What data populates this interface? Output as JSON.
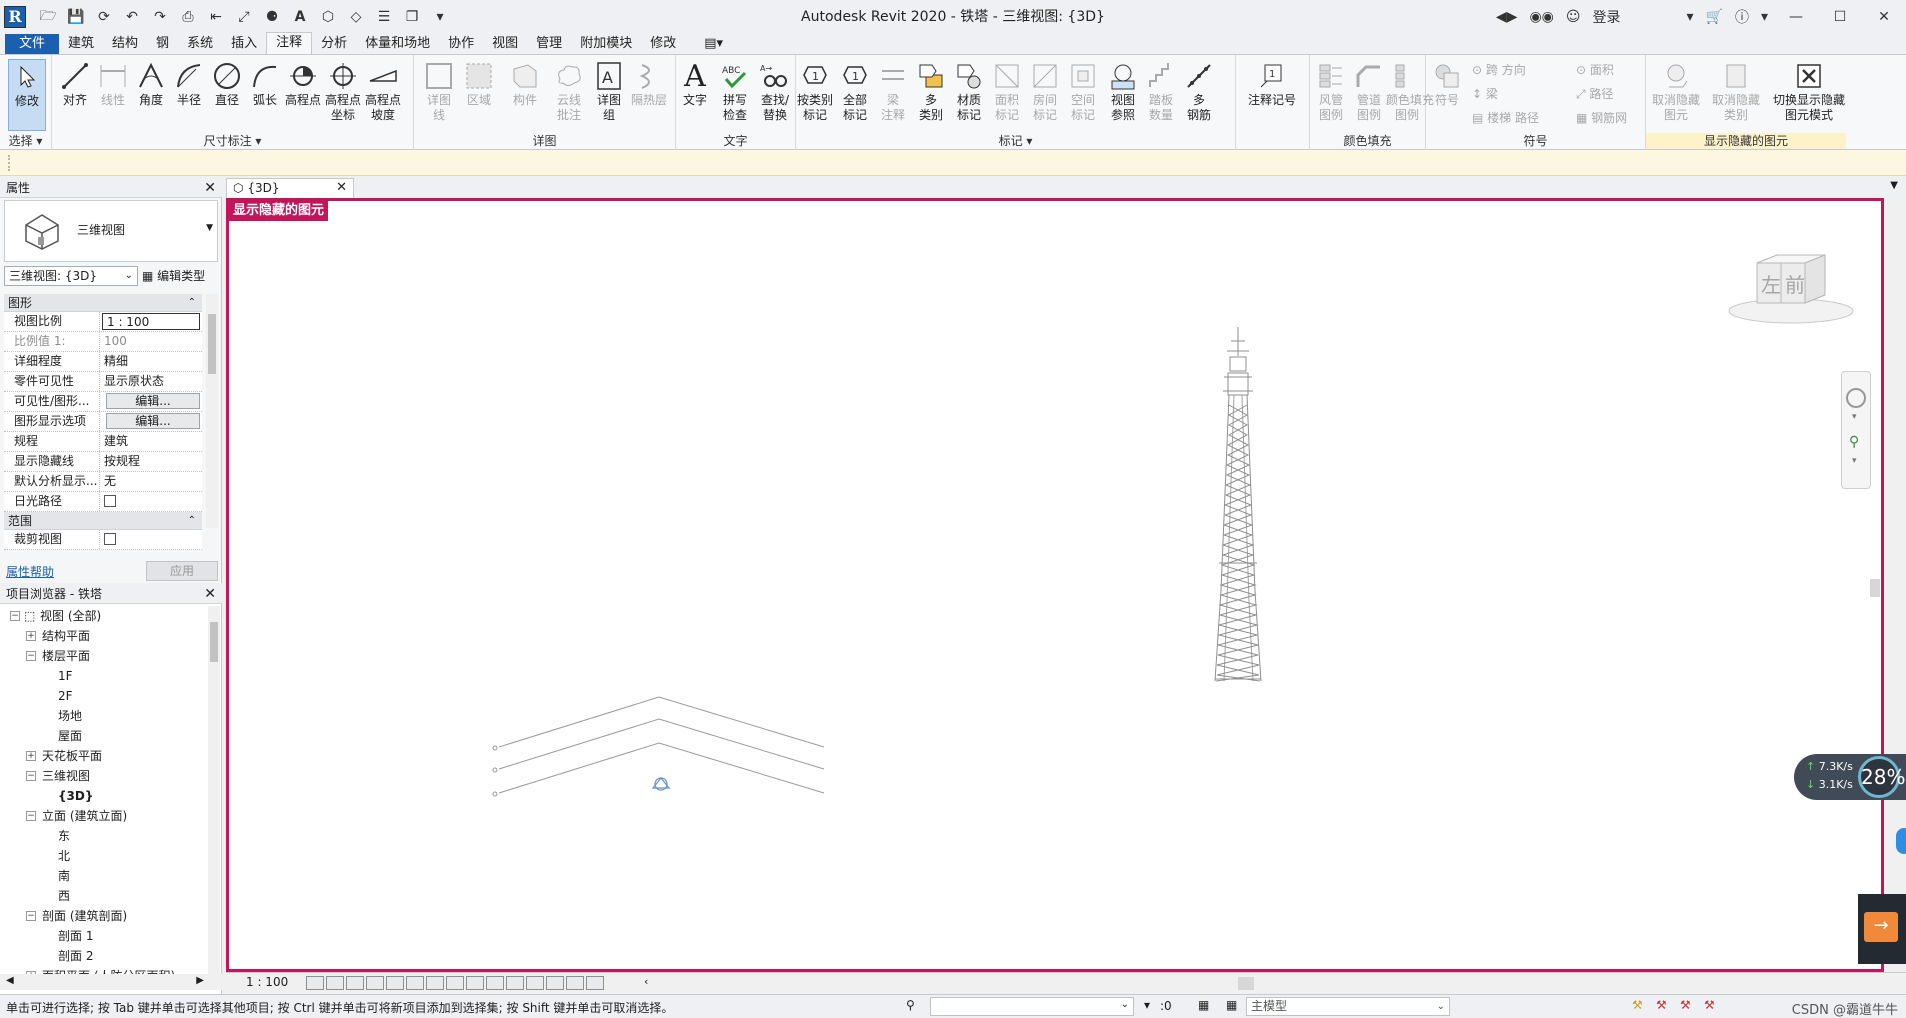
{
  "titlebar": {
    "title": "Autodesk Revit 2020 - 铁塔 - 三维视图: {3D}",
    "login_label": "登录"
  },
  "menu_tabs": [
    "文件",
    "建筑",
    "结构",
    "钢",
    "系统",
    "插入",
    "注释",
    "分析",
    "体量和场地",
    "协作",
    "视图",
    "管理",
    "附加模块",
    "修改"
  ],
  "active_tab": "注释",
  "ribbon": {
    "select_panel": {
      "modify": "修改",
      "title": "选择"
    },
    "dimension_panel": {
      "tools": [
        "对齐",
        "线性",
        "角度",
        "半径",
        "直径",
        "弧长",
        "高程点",
        "高程点\n坐标",
        "高程点\n坡度"
      ],
      "title": "尺寸标注"
    },
    "detail_panel": {
      "tools": [
        "详图\n线",
        "区域",
        "构件",
        "云线\n批注",
        "详图\n组",
        "隔热层"
      ],
      "title": "详图"
    },
    "text_panel": {
      "tools": [
        "文字",
        "拼写\n检查",
        "查找/\n替换"
      ],
      "title": "文字"
    },
    "tag_panel": {
      "tools": [
        "按类别\n标记",
        "全部\n标记",
        "梁\n注释",
        "多\n类别",
        "材质\n标记",
        "面积\n标记",
        "房间\n标记",
        "空间\n标记",
        "视图\n参照",
        "踏板\n数量",
        "多\n钢筋"
      ],
      "title": "标记"
    },
    "keynote_panel": {
      "tools": [
        "注释记号"
      ]
    },
    "color_fill_panel": {
      "tools": [
        "风管\n图例",
        "管道\n图例",
        "颜色填充\n图例"
      ],
      "title": "颜色填充"
    },
    "symbol_panel": {
      "tools": [
        "符号"
      ],
      "small_tools": [
        "跨 方向",
        "梁",
        "楼梯",
        "路径",
        "面积",
        "路径",
        "钢筋网"
      ],
      "title": "符号"
    },
    "reveal_panel": {
      "tools": [
        "取消隐藏\n图元",
        "取消隐藏\n类别",
        "切换显示隐藏\n图元模式"
      ],
      "title": "显示隐藏的图元"
    }
  },
  "properties": {
    "title": "属性",
    "type_name": "三维视图",
    "view_selector": "三维视图: {3D}",
    "edit_type": "编辑类型",
    "groups": [
      {
        "name": "图形",
        "rows": [
          {
            "k": "视图比例",
            "v": "1 : 100"
          },
          {
            "k": "比例值 1:",
            "v": "100"
          },
          {
            "k": "详细程度",
            "v": "精细"
          },
          {
            "k": "零件可见性",
            "v": "显示原状态"
          },
          {
            "k": "可见性/图形...",
            "v": "编辑..."
          },
          {
            "k": "图形显示选项",
            "v": "编辑..."
          },
          {
            "k": "规程",
            "v": "建筑"
          },
          {
            "k": "显示隐藏线",
            "v": "按规程"
          },
          {
            "k": "默认分析显示...",
            "v": "无"
          },
          {
            "k": "日光路径",
            "v": ""
          }
        ]
      },
      {
        "name": "范围",
        "rows": [
          {
            "k": "裁剪视图",
            "v": ""
          }
        ]
      }
    ],
    "help_link": "属性帮助",
    "apply_button": "应用"
  },
  "project_browser": {
    "title": "项目浏览器 - 铁塔",
    "nodes": [
      {
        "label": "视图 (全部)",
        "level": 0,
        "toggle": "−"
      },
      {
        "label": "结构平面",
        "level": 1,
        "toggle": "+"
      },
      {
        "label": "楼层平面",
        "level": 1,
        "toggle": "−"
      },
      {
        "label": "1F",
        "level": 2,
        "toggle": ""
      },
      {
        "label": "2F",
        "level": 2,
        "toggle": ""
      },
      {
        "label": "场地",
        "level": 2,
        "toggle": ""
      },
      {
        "label": "屋面",
        "level": 2,
        "toggle": ""
      },
      {
        "label": "天花板平面",
        "level": 1,
        "toggle": "+"
      },
      {
        "label": "三维视图",
        "level": 1,
        "toggle": "−"
      },
      {
        "label": "{3D}",
        "level": 2,
        "toggle": "",
        "bold": true
      },
      {
        "label": "立面 (建筑立面)",
        "level": 1,
        "toggle": "−"
      },
      {
        "label": "东",
        "level": 2,
        "toggle": ""
      },
      {
        "label": "北",
        "level": 2,
        "toggle": ""
      },
      {
        "label": "南",
        "level": 2,
        "toggle": ""
      },
      {
        "label": "西",
        "level": 2,
        "toggle": ""
      },
      {
        "label": "剖面 (建筑剖面)",
        "level": 1,
        "toggle": "−"
      },
      {
        "label": "剖面 1",
        "level": 2,
        "toggle": ""
      },
      {
        "label": "剖面 2",
        "level": 2,
        "toggle": ""
      },
      {
        "label": "面积平面 (人防分区面积)",
        "level": 1,
        "toggle": "+"
      }
    ]
  },
  "view_tab": {
    "label": "{3D}"
  },
  "viewport": {
    "hidden_mode_label": "显示隐藏的图元",
    "viewcube": {
      "left_face": "左",
      "front_face": "前"
    },
    "accent": "#c4145a"
  },
  "view_control": {
    "scale": "1 : 100"
  },
  "statusbar": {
    "message": "单击可进行选择; 按 Tab 键并单击可选择其他项目; 按 Ctrl 键并单击可将新项目添加到选择集; 按 Shift 键并单击可取消选择。",
    "filter_count": ":0",
    "model": "主模型",
    "watermark": "CSDN @霸道牛牛"
  },
  "net_widget": {
    "up": "7.3K/s",
    "down": "3.1K/s",
    "percent": "28%"
  }
}
